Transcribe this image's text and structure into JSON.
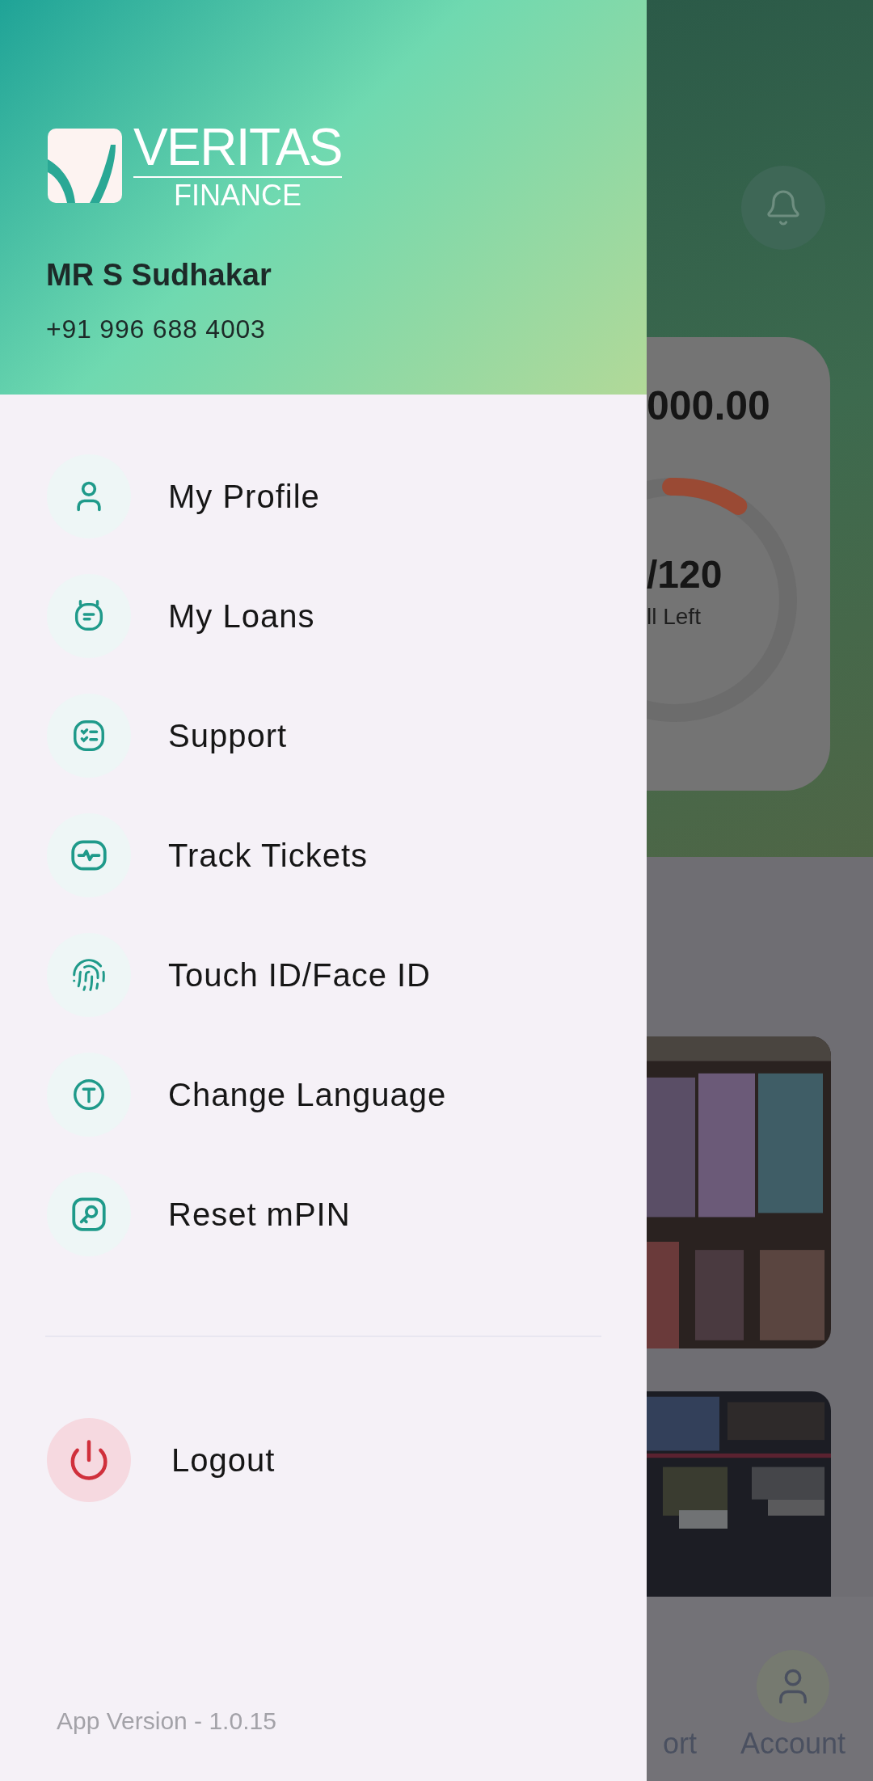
{
  "header": {
    "logo": {
      "word": "VERITAS",
      "sub": "FINANCE"
    },
    "name": "MR S Sudhakar",
    "phone": "+91 996 688 4003"
  },
  "menu": [
    {
      "label": "My Profile",
      "kind": "user"
    },
    {
      "label": "My Loans",
      "kind": "loan"
    },
    {
      "label": "Support",
      "kind": "checklist"
    },
    {
      "label": "Track Tickets",
      "kind": "pulse"
    },
    {
      "label": "Touch ID/Face ID",
      "kind": "fingerprint"
    },
    {
      "label": "Change Language",
      "kind": "language"
    },
    {
      "label": "Reset mPIN",
      "kind": "key"
    }
  ],
  "logout": {
    "label": "Logout"
  },
  "app_version": "App Version - 1.0.15",
  "background": {
    "amount": "000.00",
    "installments": "/120",
    "installments_caption": "ll Left",
    "gauge": {
      "level": 0.1
    },
    "nav": [
      {
        "label": "ort",
        "kind": "plain"
      },
      {
        "label": "Account",
        "kind": "user"
      }
    ]
  }
}
